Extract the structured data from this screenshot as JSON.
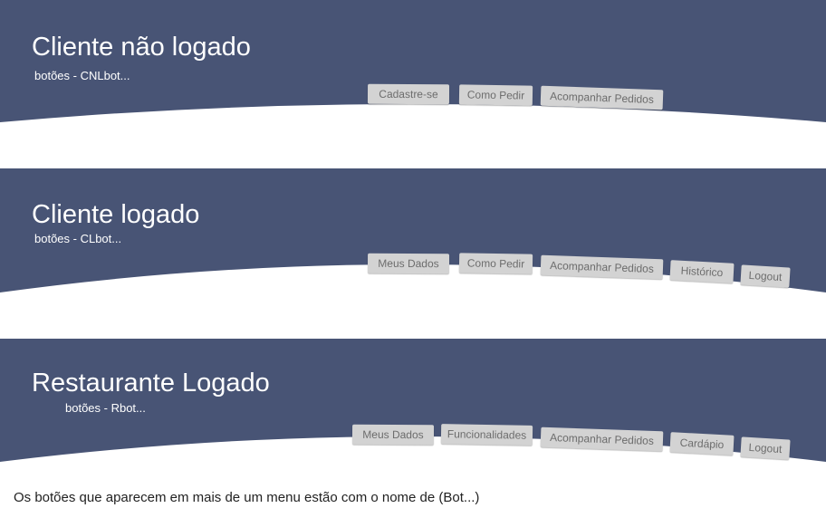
{
  "colors": {
    "banner": "#485475",
    "tab_bg": "#d3d3d3",
    "tab_text": "#6d6d6d"
  },
  "menus": [
    {
      "title": "Cliente não logado",
      "subtitle": "botões - CNLbot...",
      "buttons": [
        "Cadastre-se",
        "Como Pedir",
        "Acompanhar Pedidos"
      ]
    },
    {
      "title": "Cliente logado",
      "subtitle": "botões - CLbot...",
      "buttons": [
        "Meus Dados",
        "Como Pedir",
        "Acompanhar Pedidos",
        "Histórico",
        "Logout"
      ]
    },
    {
      "title": "Restaurante Logado",
      "subtitle": "botões - Rbot...",
      "buttons": [
        "Meus Dados",
        "Funcionalidades",
        "Acompanhar Pedidos",
        "Cardápio",
        "Logout"
      ]
    }
  ],
  "footnote": "Os botões que aparecem em mais de um menu estão com o nome de (Bot...)"
}
